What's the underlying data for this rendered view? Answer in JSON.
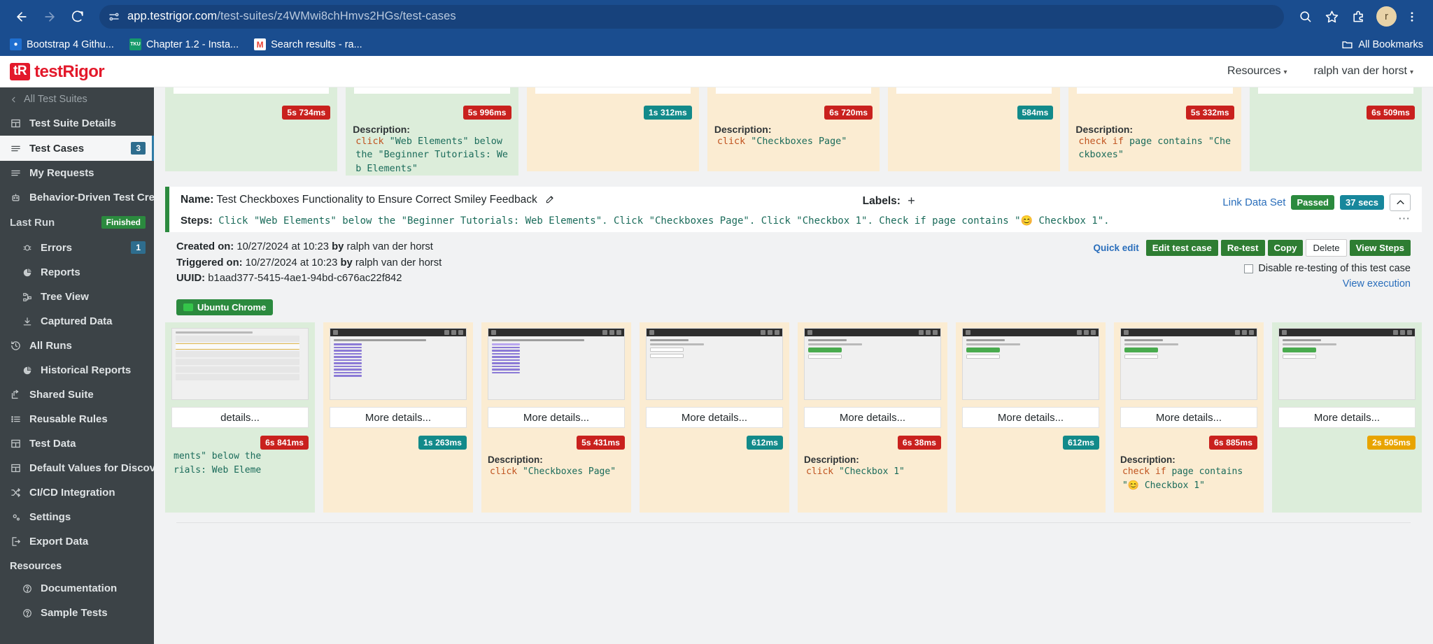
{
  "browser": {
    "url_bold": "app.testrigor.com",
    "url_dim": "/test-suites/z4WMwi8chHmvs2HGs/test-cases",
    "back_icon": "back-arrow-icon",
    "forward_icon": "forward-arrow-icon",
    "reload_icon": "reload-icon",
    "site_info_icon": "site-settings-icon",
    "search_icon": "search-icon",
    "bookmark_icon": "star-icon",
    "extensions_icon": "extensions-icon",
    "profile_initial": "r",
    "menu_icon": "kebab-menu-icon",
    "bookmarks": [
      {
        "label": "Bootstrap 4 Githu...",
        "icon": "globe-icon",
        "color": "#1f6fd0",
        "glyph": "●"
      },
      {
        "label": "Chapter 1.2 - Insta...",
        "icon": "tku-icon",
        "color": "#169a6b",
        "glyph": "TKU"
      },
      {
        "label": "Search results - ra...",
        "icon": "gmail-icon",
        "color": "#ffffff",
        "glyph": "M"
      }
    ],
    "all_bookmarks": "All Bookmarks",
    "all_bookmarks_icon": "folder-icon"
  },
  "brand": {
    "mark": "tR",
    "name": "testRigor"
  },
  "sidebar": {
    "back_label": "All Test Suites",
    "back_icon": "chevron-left-icon",
    "items": [
      {
        "label": "Test Suite Details",
        "icon": "grid-icon",
        "active": false,
        "sub": false
      },
      {
        "label": "Test Cases",
        "icon": "list-icon",
        "active": true,
        "sub": false,
        "badge": "3"
      },
      {
        "label": "My Requests",
        "icon": "list-icon",
        "active": false,
        "sub": false
      },
      {
        "label": "Behavior-Driven Test Creation",
        "icon": "robot-icon",
        "active": false,
        "sub": false
      }
    ],
    "last_run": {
      "label": "Last Run",
      "status": "Finished"
    },
    "run_items": [
      {
        "label": "Errors",
        "icon": "bug-icon",
        "sub": true,
        "badge": "1"
      },
      {
        "label": "Reports",
        "icon": "pie-chart-icon",
        "sub": true
      },
      {
        "label": "Tree View",
        "icon": "tree-icon",
        "sub": true
      },
      {
        "label": "Captured Data",
        "icon": "download-icon",
        "sub": true
      }
    ],
    "all_runs": {
      "label": "All Runs",
      "icon": "history-icon"
    },
    "all_runs_sub": [
      {
        "label": "Historical Reports",
        "icon": "pie-chart-icon",
        "sub": true
      }
    ],
    "items2": [
      {
        "label": "Shared Suite",
        "icon": "share-icon",
        "sub": false
      },
      {
        "label": "Reusable Rules",
        "icon": "bullet-list-icon",
        "sub": false
      },
      {
        "label": "Test Data",
        "icon": "table-icon",
        "sub": false
      },
      {
        "label": "Default Values for Discovery",
        "icon": "table-icon",
        "sub": false
      },
      {
        "label": "CI/CD Integration",
        "icon": "shuffle-icon",
        "sub": false
      },
      {
        "label": "Settings",
        "icon": "gear-icon",
        "sub": false
      },
      {
        "label": "Export Data",
        "icon": "export-icon",
        "sub": false
      }
    ],
    "resources_group": "Resources",
    "resources": [
      {
        "label": "Documentation",
        "icon": "question-circle-icon",
        "sub": true
      },
      {
        "label": "Sample Tests",
        "icon": "question-circle-icon",
        "sub": true
      }
    ]
  },
  "topbar": {
    "resources": "Resources",
    "user": "ralph van der horst",
    "caret": "▾"
  },
  "top_cards": [
    {
      "status": "pass",
      "chip": "5s 734ms",
      "chip_color": "red",
      "desc_label": "",
      "desc": ""
    },
    {
      "status": "pass",
      "chip": "5s 996ms",
      "chip_color": "red",
      "desc_label": "Description:",
      "desc_kw": "click",
      "desc_rest": " \"Web Elements\" below the \"Beginner Tutorials: Web Elements\""
    },
    {
      "status": "warn",
      "chip": "1s 312ms",
      "chip_color": "teal",
      "desc_label": "",
      "desc": ""
    },
    {
      "status": "warn",
      "chip": "6s 720ms",
      "chip_color": "red",
      "desc_label": "Description:",
      "desc_kw": "click",
      "desc_rest": " \"Checkboxes Page\""
    },
    {
      "status": "warn",
      "chip": "584ms",
      "chip_color": "teal",
      "desc_label": "",
      "desc": ""
    },
    {
      "status": "warn",
      "chip": "5s 332ms",
      "chip_color": "red",
      "desc_label": "Description:",
      "desc_kw": "check if",
      "desc_rest": " page contains \"Checkboxes\""
    },
    {
      "status": "pass",
      "chip": "6s 509ms",
      "chip_color": "red",
      "desc_label": "",
      "desc": ""
    }
  ],
  "detail": {
    "name_label": "Name:",
    "name_value": "Test Checkboxes Functionality to Ensure Correct Smiley Feedback",
    "edit_icon": "edit-pencil-icon",
    "labels_label": "Labels:",
    "labels_plus": "+",
    "steps_label": "Steps:",
    "steps_text": "Click \"Web Elements\" below the \"Beginner Tutorials: Web Elements\". Click \"Checkboxes Page\". Click \"Checkbox 1\". Check if page contains \"😊 Checkbox 1\".",
    "link_data_set": "Link Data Set",
    "status_pill": "Passed",
    "duration_pill": "37 secs",
    "collapse_icon": "chevron-up-icon",
    "more_icon": "ellipsis-icon"
  },
  "meta": {
    "created_label": "Created on:",
    "created_value": "10/27/2024 at 10:23",
    "created_by_label": "by",
    "created_by": "ralph van der horst",
    "triggered_label": "Triggered on:",
    "triggered_value": "10/27/2024 at 10:23",
    "triggered_by_label": "by",
    "triggered_by": "ralph van der horst",
    "uuid_label": "UUID:",
    "uuid_value": "b1aad377-5415-4ae1-94bd-c676ac22f842"
  },
  "actions": {
    "quick_edit": "Quick edit",
    "edit_test_case": "Edit test case",
    "retest": "Re-test",
    "copy": "Copy",
    "delete": "Delete",
    "view_steps": "View Steps",
    "disable_retest": "Disable re-testing of this test case",
    "view_execution": "View execution"
  },
  "browser_badge": {
    "label": "Ubuntu Chrome",
    "icon": "ubuntu-chrome-icon"
  },
  "shot_cards": [
    {
      "status": "pass",
      "chip": "6s 841ms",
      "chip_color": "red",
      "more": "details...",
      "thumb": "table",
      "desc_label": "",
      "desc_pre": "ments\" below the",
      "desc_post": "rials: Web Eleme"
    },
    {
      "status": "warn",
      "chip": "1s 263ms",
      "chip_color": "teal",
      "more": "More details...",
      "thumb": "links",
      "desc_label": "",
      "desc_kw": "",
      "desc_rest": ""
    },
    {
      "status": "warn",
      "chip": "5s 431ms",
      "chip_color": "red",
      "more": "More details...",
      "thumb": "links",
      "desc_label": "Description:",
      "desc_kw": "click",
      "desc_rest": " \"Checkboxes Page\""
    },
    {
      "status": "warn",
      "chip": "612ms",
      "chip_color": "teal",
      "more": "More details...",
      "thumb": "checkbox",
      "desc_label": "",
      "desc_kw": "",
      "desc_rest": ""
    },
    {
      "status": "warn",
      "chip": "6s 38ms",
      "chip_color": "red",
      "more": "More details...",
      "thumb": "checkbox",
      "desc_label": "Description:",
      "desc_kw": "click",
      "desc_rest": " \"Checkbox 1\""
    },
    {
      "status": "warn",
      "chip": "612ms",
      "chip_color": "teal",
      "more": "More details...",
      "thumb": "checkgreen",
      "desc_label": "",
      "desc_kw": "",
      "desc_rest": ""
    },
    {
      "status": "warn",
      "chip": "6s 885ms",
      "chip_color": "red",
      "more": "More details...",
      "thumb": "checkgreen",
      "desc_label": "Description:",
      "desc_kw": "check if",
      "desc_rest": " page contains \"😊 Checkbox 1\""
    },
    {
      "status": "pass",
      "chip": "2s 505ms",
      "chip_color": "amber",
      "more": "More details...",
      "thumb": "checkgreen",
      "desc_label": "",
      "desc_kw": "",
      "desc_rest": ""
    }
  ]
}
